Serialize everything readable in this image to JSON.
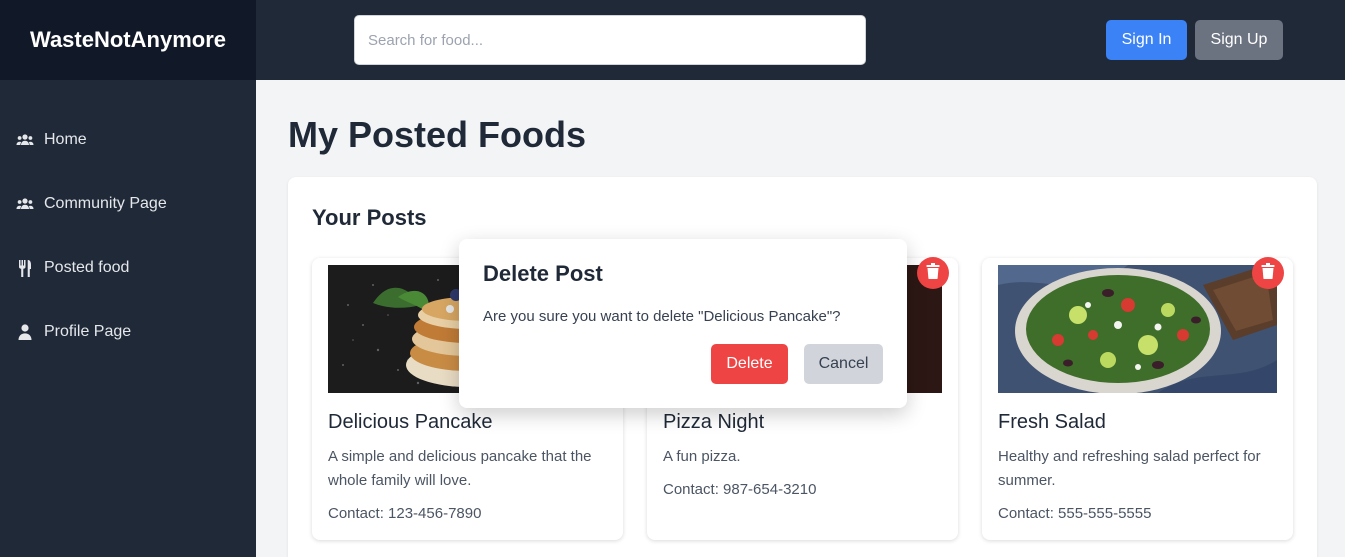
{
  "brand": {
    "name": "WasteNotAnymore"
  },
  "search": {
    "placeholder": "Search for food..."
  },
  "header": {
    "signin_label": "Sign In",
    "signup_label": "Sign Up"
  },
  "sidebar": {
    "items": [
      {
        "label": "Home",
        "icon": "users-icon"
      },
      {
        "label": "Community Page",
        "icon": "users-icon"
      },
      {
        "label": "Posted food",
        "icon": "utensils-icon"
      },
      {
        "label": "Profile Page",
        "icon": "user-icon"
      }
    ]
  },
  "main": {
    "title": "My Posted Foods",
    "section_title": "Your Posts",
    "posts": [
      {
        "title": "Delicious Pancake",
        "description": "A simple and delicious pancake that the whole family will love.",
        "contact": "Contact: 123-456-7890",
        "image": "pancake-photo"
      },
      {
        "title": "Pizza Night",
        "description": "A fun pizza.",
        "contact": "Contact: 987-654-3210",
        "image": "pizza-photo"
      },
      {
        "title": "Fresh Salad",
        "description": "Healthy and refreshing salad perfect for summer.",
        "contact": "Contact: 555-555-5555",
        "image": "salad-photo"
      }
    ]
  },
  "modal": {
    "title": "Delete Post",
    "message": "Are you sure you want to delete \"Delicious Pancake\"?",
    "delete_label": "Delete",
    "cancel_label": "Cancel"
  },
  "colors": {
    "sidebar_bg": "#1f2937",
    "brand_bg": "#111827",
    "primary": "#3b82f6",
    "danger": "#ef4444",
    "secondary": "#6b7280"
  }
}
